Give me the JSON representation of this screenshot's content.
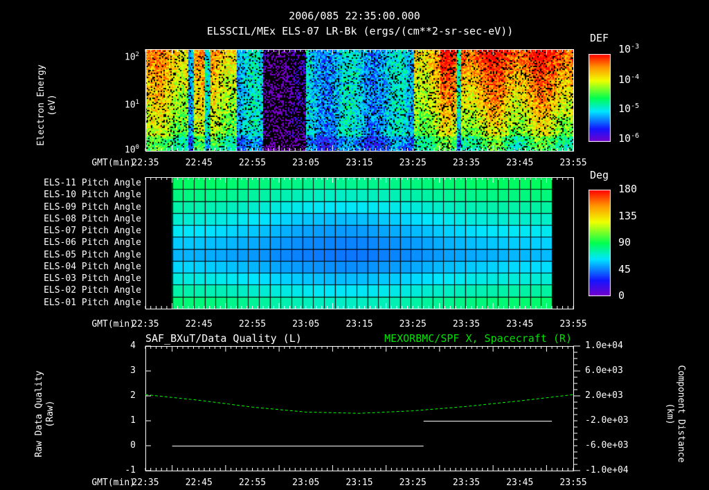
{
  "header": {
    "date": "2006/085 22:35:00.000",
    "title": "ELSSCIL/MEx ELS-07 LR-Bk  (ergs/(cm**2-sr-sec-eV))"
  },
  "time_axis": {
    "label": "GMT(min)",
    "ticks": [
      "22:35",
      "22:45",
      "22:55",
      "23:05",
      "23:15",
      "23:25",
      "23:35",
      "23:45",
      "23:55"
    ]
  },
  "chart_data": [
    {
      "type": "heatmap",
      "name": "electron-spectrogram",
      "ylabel": "Electron Energy",
      "yunit": "(eV)",
      "yscale": "log",
      "ylim": [
        1,
        150
      ],
      "yticks": [
        "10^0",
        "10^1",
        "10^2"
      ],
      "xlim": [
        "22:35",
        "23:55"
      ],
      "colorbar": {
        "label": "DEF",
        "ticks": [
          "10^-3",
          "10^-4",
          "10^-5",
          "10^-6"
        ],
        "range": [
          1e-06,
          0.001
        ]
      },
      "high_flux_intervals": [
        [
          "22:35",
          "22:43"
        ],
        [
          "22:44",
          "22:46"
        ],
        [
          "22:47",
          "22:52"
        ],
        [
          "23:25",
          "23:33"
        ],
        [
          "23:34",
          "23:55"
        ]
      ],
      "quiet_intervals": [
        [
          "22:57",
          "23:05"
        ]
      ]
    },
    {
      "type": "heatmap",
      "name": "pitch-angle",
      "rows": [
        "ELS-11 Pitch Angle",
        "ELS-10 Pitch Angle",
        "ELS-09 Pitch Angle",
        "ELS-08 Pitch Angle",
        "ELS-07 Pitch Angle",
        "ELS-06 Pitch Angle",
        "ELS-05 Pitch Angle",
        "ELS-04 Pitch Angle",
        "ELS-03 Pitch Angle",
        "ELS-02 Pitch Angle",
        "ELS-01 Pitch Angle"
      ],
      "xrange": [
        "22:40",
        "23:51"
      ],
      "columns": 35,
      "row_edge_values": [
        88,
        84,
        78,
        72,
        66,
        60,
        56,
        62,
        70,
        78,
        86
      ],
      "row_center_values": [
        80,
        72,
        64,
        56,
        50,
        46,
        44,
        48,
        56,
        64,
        72
      ],
      "colorbar": {
        "label": "Deg",
        "ticks": [
          "180",
          "135",
          "90",
          "45",
          "0"
        ],
        "range": [
          0,
          180
        ]
      }
    },
    {
      "type": "line",
      "name": "data-quality",
      "title_left": "SAF_BXuT/Data Quality (L)",
      "title_right": "MEXORBMC/SPF X, Spacecraft (R)",
      "ylabel_left": "Raw Data Quality",
      "yunit_left": "(Raw)",
      "ylim_left": [
        -1,
        4
      ],
      "yticks_left": [
        "4",
        "3",
        "2",
        "1",
        "0",
        "-1"
      ],
      "ylabel_right": "Component Distance",
      "yunit_right": "(km)",
      "ylim_right": [
        -10000,
        10000
      ],
      "yticks_right": [
        "1.0e+04",
        "6.0e+03",
        "2.0e+03",
        "-2.0e+03",
        "-6.0e+03",
        "-1.0e+04"
      ],
      "series": [
        {
          "name": "Data Quality",
          "color": "#ffffff",
          "axis": "left",
          "segments": [
            {
              "x": [
                "22:40",
                "23:27"
              ],
              "y": 0
            },
            {
              "x": [
                "23:27",
                "23:51"
              ],
              "y": 1
            }
          ]
        },
        {
          "name": "SPF X, Spacecraft",
          "color": "#00ff00",
          "axis": "right",
          "dashed": true,
          "x_min": [
            0,
            10,
            20,
            30,
            40,
            50,
            60,
            70,
            80
          ],
          "y": [
            2200,
            1300,
            200,
            -600,
            -800,
            -400,
            300,
            1200,
            2200
          ]
        }
      ]
    }
  ],
  "colors": {
    "green_title": "#00e000",
    "text": "#ffffff"
  }
}
